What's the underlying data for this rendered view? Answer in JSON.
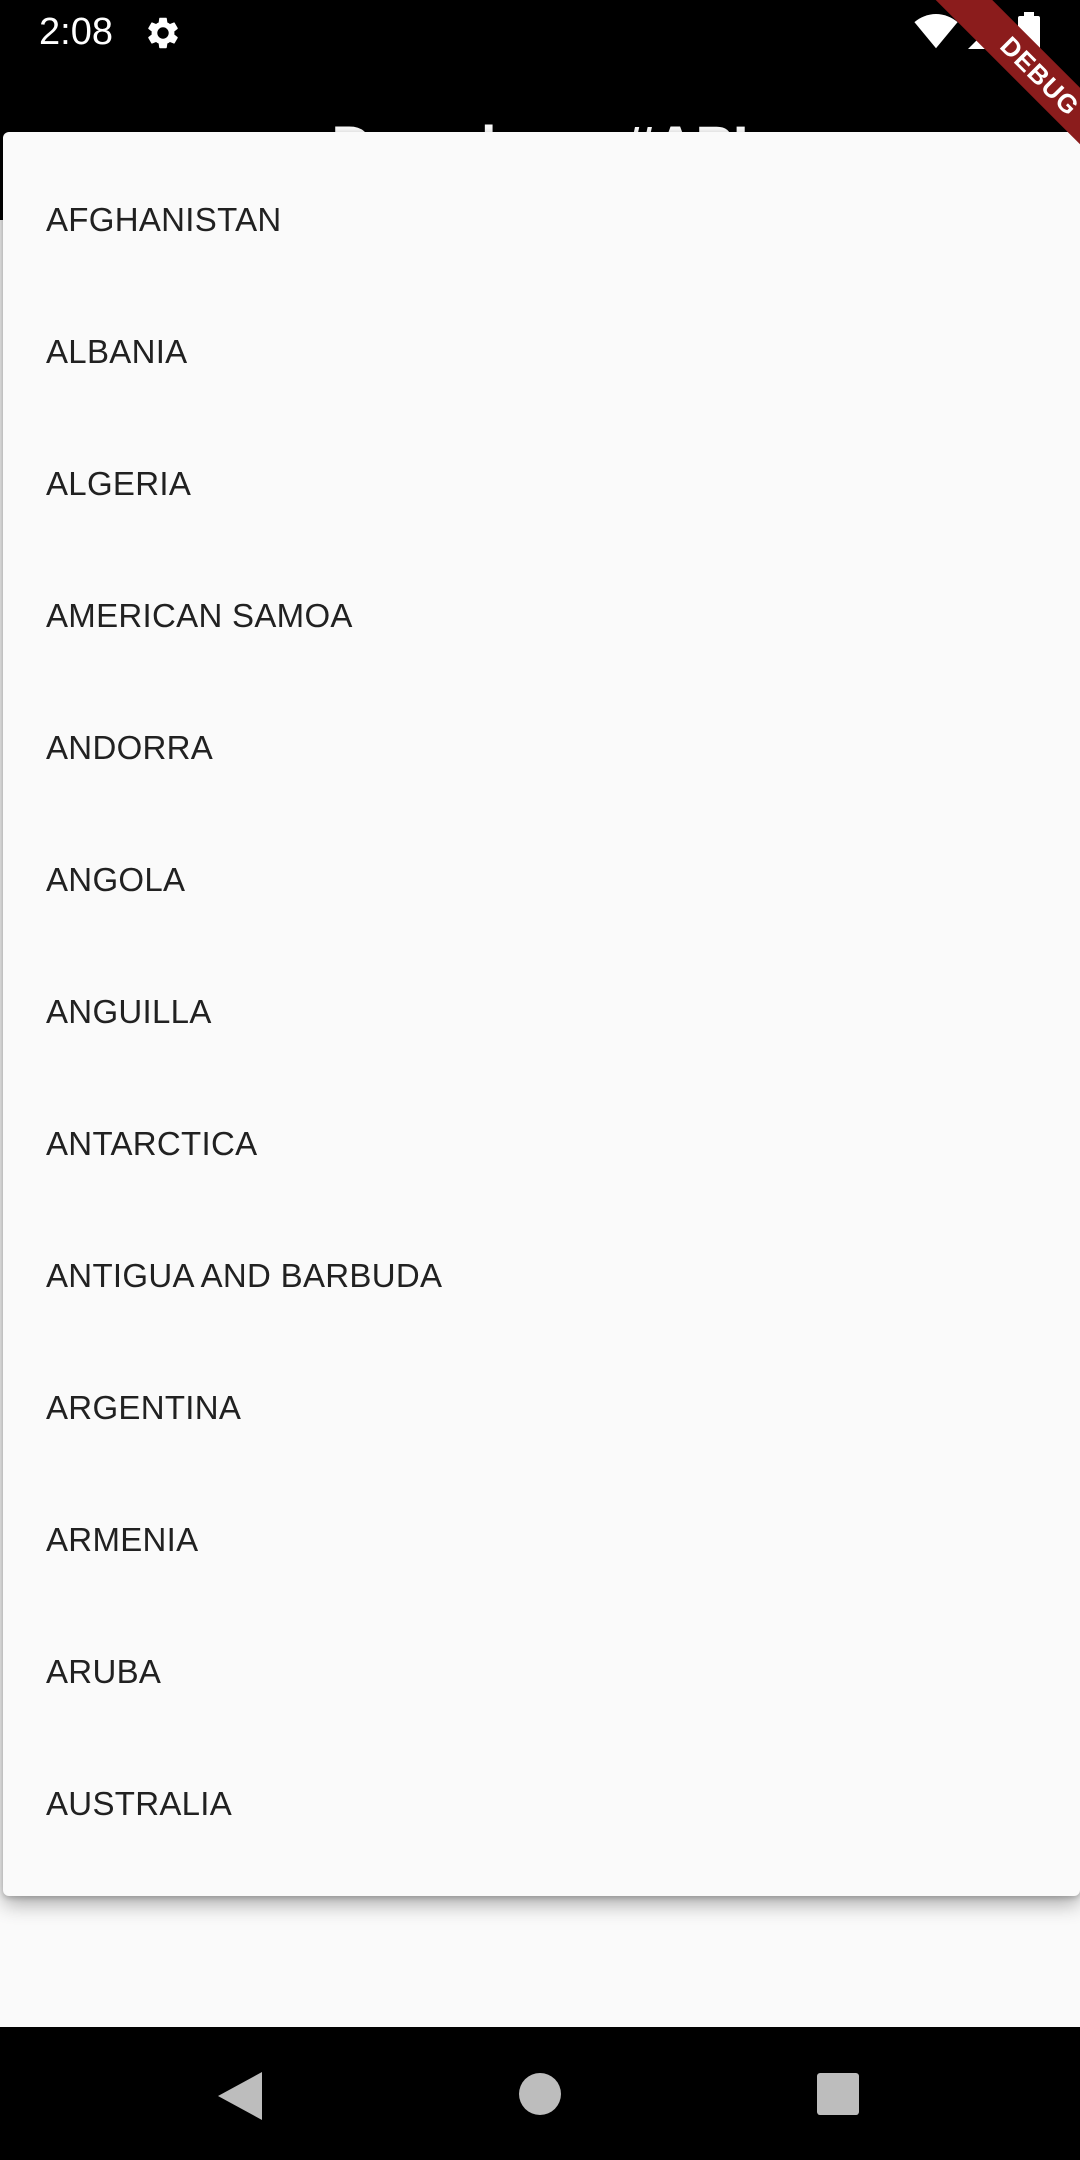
{
  "status_bar": {
    "time": "2:08",
    "icons": [
      "settings-gear-icon",
      "wifi-icon",
      "cell-signal-icon",
      "battery-icon"
    ]
  },
  "app_bar": {
    "title": "Dropdown #API"
  },
  "debug_banner": {
    "label": "DEBUG"
  },
  "dropdown": {
    "items": [
      {
        "label": "AFGHANISTAN"
      },
      {
        "label": "ALBANIA"
      },
      {
        "label": "ALGERIA"
      },
      {
        "label": "AMERICAN SAMOA"
      },
      {
        "label": "ANDORRA"
      },
      {
        "label": "ANGOLA"
      },
      {
        "label": "ANGUILLA"
      },
      {
        "label": "ANTARCTICA"
      },
      {
        "label": "ANTIGUA AND BARBUDA"
      },
      {
        "label": "ARGENTINA"
      },
      {
        "label": "ARMENIA"
      },
      {
        "label": "ARUBA"
      },
      {
        "label": "AUSTRALIA"
      }
    ]
  },
  "nav_bar": {
    "icons": [
      "back-icon",
      "home-icon",
      "recent-apps-icon"
    ]
  },
  "colors": {
    "background": "#fafafa",
    "bar": "#000000",
    "text": "#212121",
    "debug_ribbon": "#8b1c1c"
  }
}
